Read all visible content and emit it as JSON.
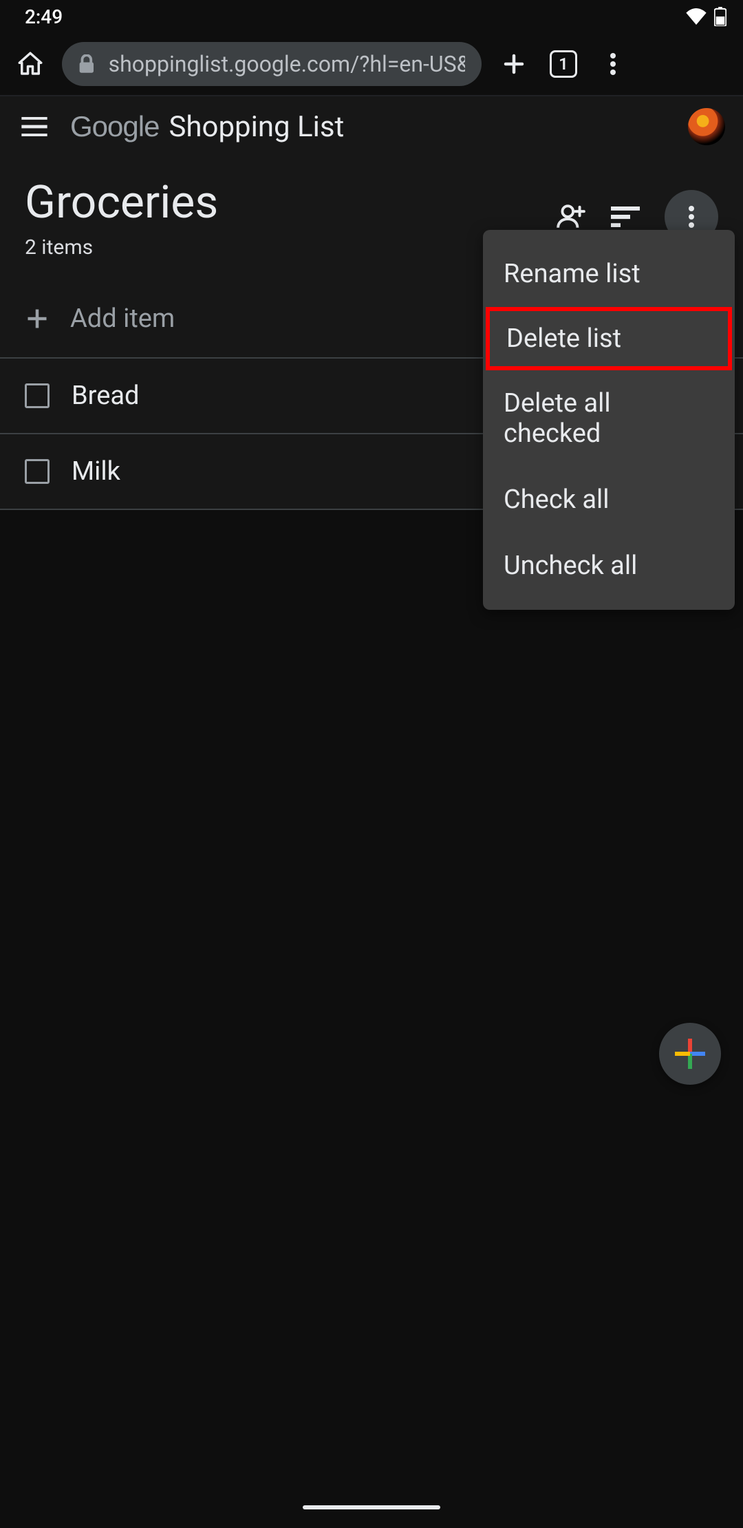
{
  "status": {
    "time": "2:49"
  },
  "browser": {
    "url": "shoppinglist.google.com/?hl=en-US&",
    "tab_count": "1"
  },
  "header": {
    "logo": "Google",
    "app_title": "Shopping List"
  },
  "list": {
    "title": "Groceries",
    "subtitle": "2 items",
    "add_placeholder": "Add item",
    "items": [
      {
        "label": "Bread"
      },
      {
        "label": "Milk"
      }
    ]
  },
  "menu": {
    "items": [
      {
        "label": "Rename list",
        "highlighted": false
      },
      {
        "label": "Delete list",
        "highlighted": true
      },
      {
        "label": "Delete all checked",
        "highlighted": false
      },
      {
        "label": "Check all",
        "highlighted": false
      },
      {
        "label": "Uncheck all",
        "highlighted": false
      }
    ]
  }
}
